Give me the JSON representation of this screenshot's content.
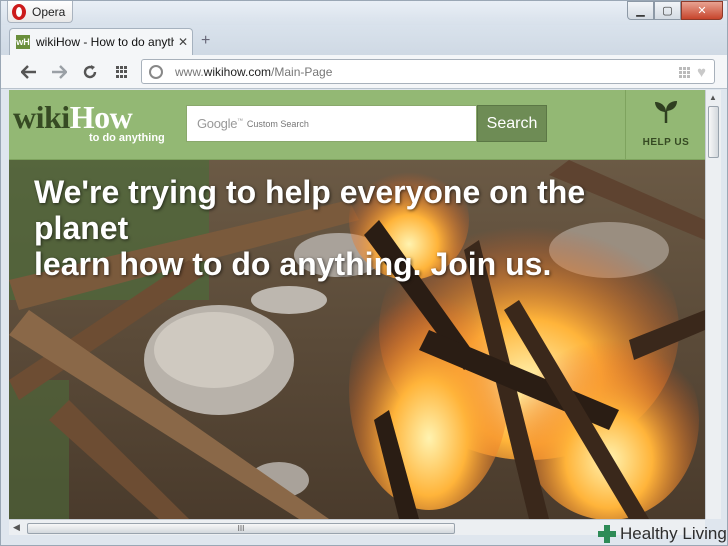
{
  "browser": {
    "menu_label": "Opera",
    "tab_title": "wikiHow - How to do anything",
    "tab_favicon": "wH",
    "url_prefix": "www.",
    "url_domain": "wikihow.com",
    "url_path": "/Main-Page"
  },
  "site": {
    "logo_wiki": "wiki",
    "logo_how": "How",
    "tagline": "to do anything",
    "search_brand": "Google",
    "search_placeholder": "Custom Search",
    "search_button": "Search",
    "help_label": "HELP US"
  },
  "hero": {
    "line1": "We're trying to help everyone on the",
    "line2": "planet",
    "line3": "learn how to do anything. Join us."
  },
  "scrollbar": {
    "grip": "III"
  },
  "watermark": {
    "text": "Healthy Living"
  },
  "colors": {
    "header_green": "#93b874",
    "search_button": "#6e8c55",
    "logo_dark": "#364a23"
  }
}
